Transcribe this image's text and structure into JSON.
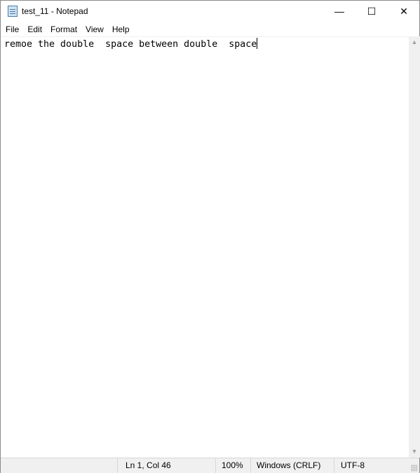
{
  "window": {
    "title": "test_11 - Notepad",
    "minimize": "—",
    "maximize": "☐",
    "close": "✕"
  },
  "menu": [
    "File",
    "Edit",
    "Format",
    "View",
    "Help"
  ],
  "editor": {
    "text": "remoe the double  space between double  space"
  },
  "scrollbar": {
    "up": "▲",
    "down": "▼"
  },
  "status": {
    "position": "Ln 1, Col 46",
    "zoom": "100%",
    "line_ending": "Windows (CRLF)",
    "encoding": "UTF-8"
  }
}
